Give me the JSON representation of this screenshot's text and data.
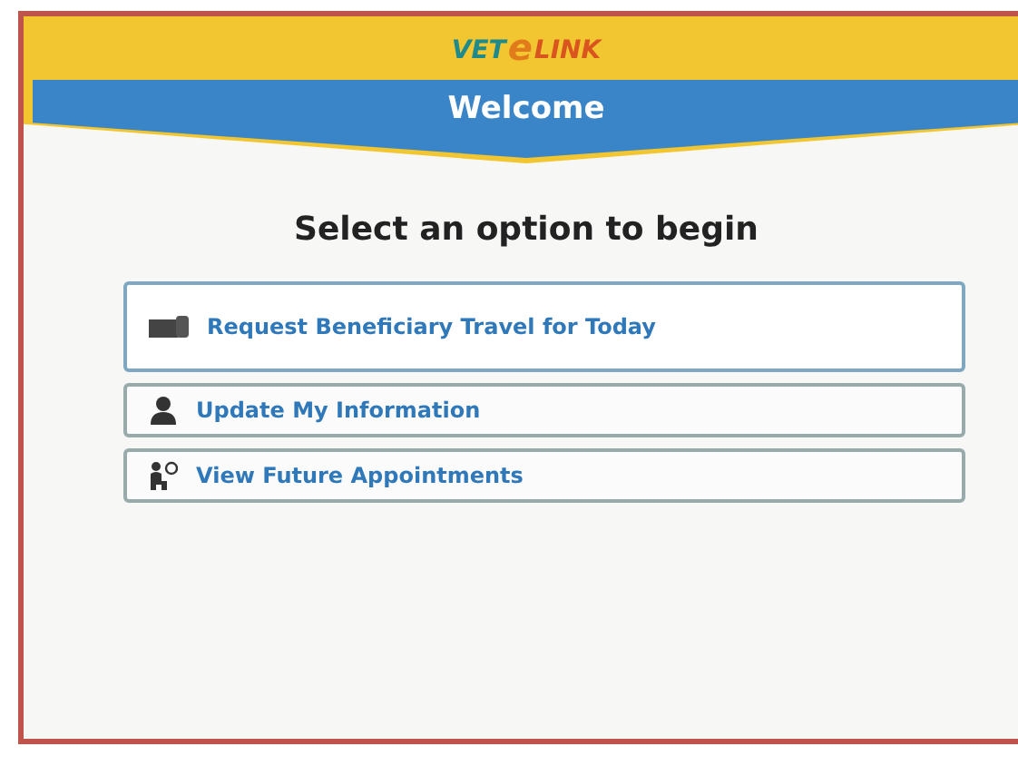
{
  "header": {
    "logo": [
      "VET",
      "e",
      "LINK"
    ],
    "banner_title": "Welcome"
  },
  "heading": "Select an option to begin",
  "options": [
    {
      "kind": "travel",
      "label": "Request Beneficiary Travel for Today",
      "selected": true
    },
    {
      "kind": "person",
      "label": "Update My Information",
      "selected": false
    },
    {
      "kind": "appointments",
      "label": "View Future Appointments",
      "selected": false
    }
  ]
}
